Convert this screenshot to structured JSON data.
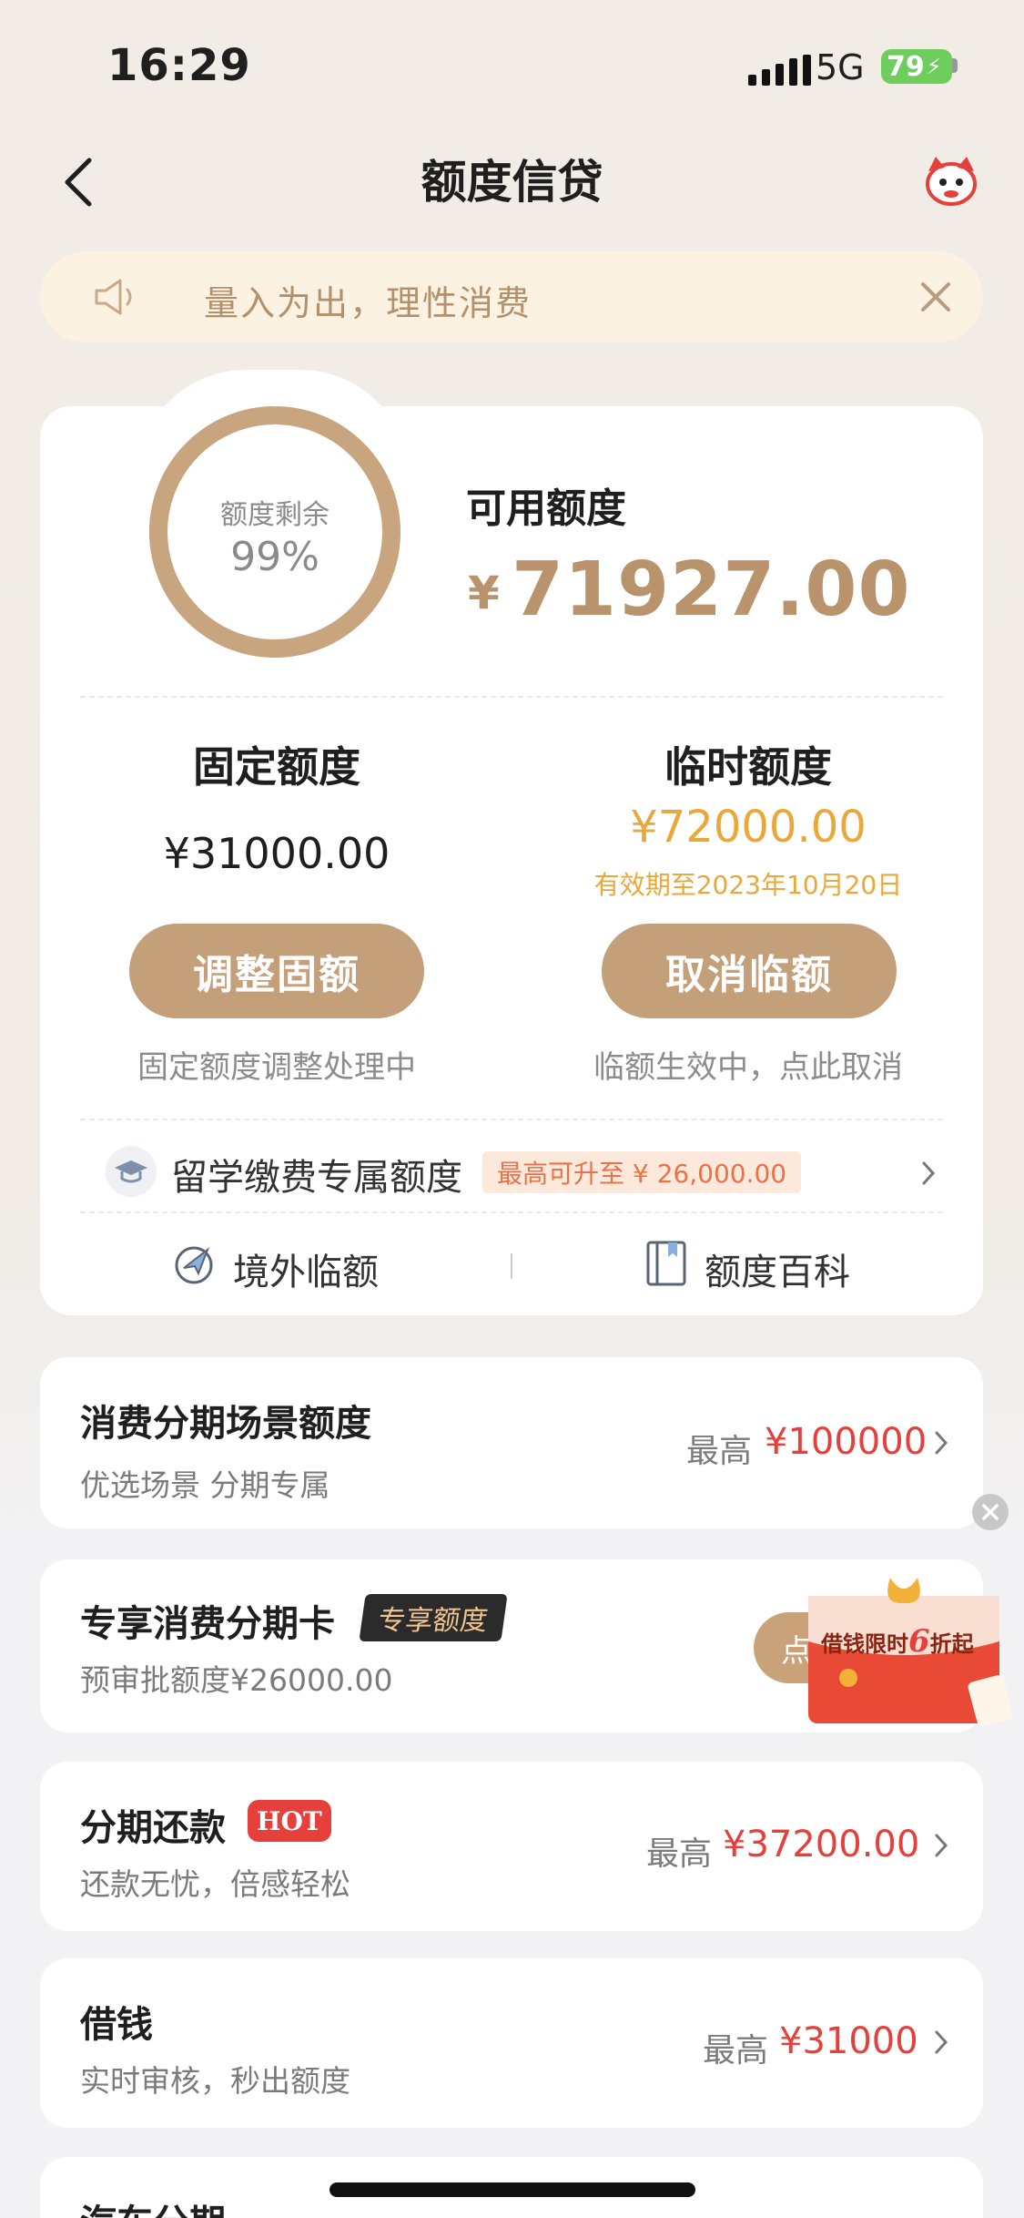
{
  "status_bar": {
    "time": "16:29",
    "network": "5G",
    "battery": "79"
  },
  "nav": {
    "title": "额度信贷"
  },
  "notice": {
    "text": "量入为出，理性消费"
  },
  "credit": {
    "ring_label": "额度剩余",
    "ring_percent_text": "99%",
    "ring_fraction": 0.99,
    "available_label": "可用额度",
    "currency_symbol": "¥",
    "available_amount": "71927.00",
    "fixed": {
      "title": "固定额度",
      "amount": "¥31000.00",
      "button": "调整固额",
      "note": "固定额度调整处理中"
    },
    "temporary": {
      "title": "临时额度",
      "amount": "¥72000.00",
      "validity": "有效期至2023年10月20日",
      "button": "取消临额",
      "note": "临额生效中，点此取消"
    },
    "study": {
      "label": "留学缴费专属额度",
      "badge": "最高可升至 ¥ 26,000.00"
    },
    "links": [
      {
        "label": "境外临额",
        "icon": "plane-globe-icon"
      },
      {
        "label": "额度百科",
        "icon": "book-icon"
      }
    ]
  },
  "colors": {
    "accent": "#c4a07a",
    "amount_gold": "#b8936b",
    "temp_orange": "#eba83a",
    "price_red": "#e5403b"
  },
  "products": [
    {
      "title": "消费分期场景额度",
      "subtitle": "优选场景 分期专属",
      "max_label": "最高",
      "max_amount": "¥100000"
    },
    {
      "title": "专享消费分期卡",
      "badge": "专享额度",
      "subtitle": "预审批额度¥26000.00",
      "button_partial": "点"
    },
    {
      "title": "分期还款",
      "badge": "HOT",
      "subtitle": "还款无忧，倍感轻松",
      "max_label": "最高",
      "max_amount": "¥37200.00"
    },
    {
      "title": "借钱",
      "subtitle": "实时审核，秒出额度",
      "max_label": "最高",
      "max_amount": "¥31000"
    },
    {
      "title": "汽车分期"
    }
  ],
  "promo": {
    "text_before": "借钱限时",
    "text_highlight": "6",
    "text_after": "折起"
  }
}
